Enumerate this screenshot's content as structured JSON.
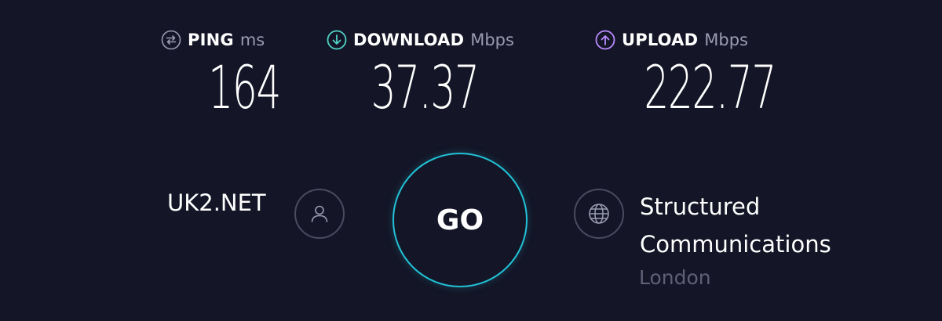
{
  "metrics": {
    "ping": {
      "label": "PING",
      "unit": "ms",
      "value": "164",
      "icon": "ping-icon"
    },
    "download": {
      "label": "DOWNLOAD",
      "unit": "Mbps",
      "value": "37.37",
      "icon": "download-arrow-icon",
      "color": "#4fd1c5"
    },
    "upload": {
      "label": "UPLOAD",
      "unit": "Mbps",
      "value": "222.77",
      "icon": "upload-arrow-icon",
      "color": "#b98cff"
    }
  },
  "isp": {
    "name": "UK2.NET",
    "icon": "user-icon"
  },
  "go_button": {
    "label": "GO",
    "color": "#22c1d6"
  },
  "server": {
    "line1": "Structured",
    "line2": "Communications",
    "location": "London",
    "icon": "globe-icon"
  },
  "colors": {
    "background": "#141526",
    "text": "#ffffff",
    "muted": "#9a9bb1"
  }
}
